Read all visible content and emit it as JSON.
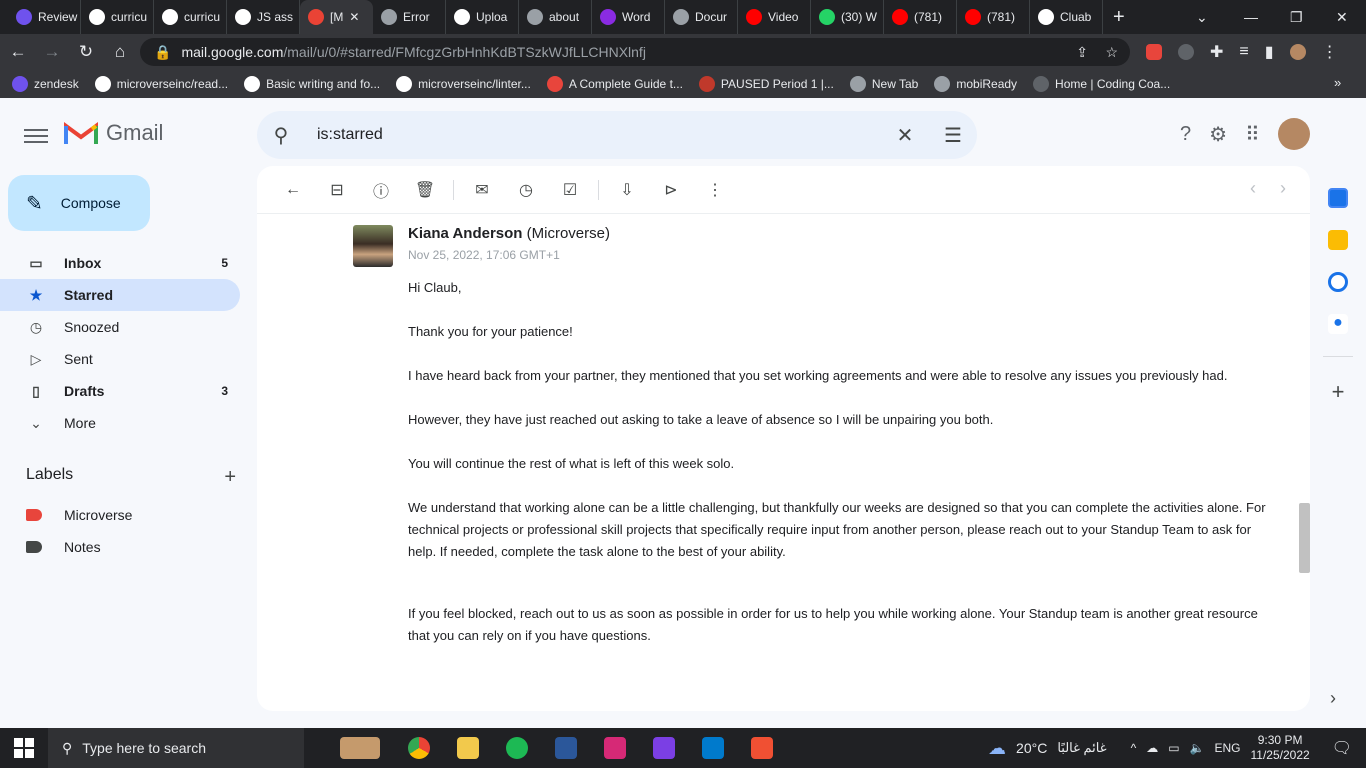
{
  "browser": {
    "tabs": [
      {
        "label": "Review",
        "favicon": "#6f52ed"
      },
      {
        "label": "curricu",
        "favicon": "#ffffff"
      },
      {
        "label": "curricu",
        "favicon": "#ffffff"
      },
      {
        "label": "JS ass",
        "favicon": "#ffffff"
      },
      {
        "label": "[M",
        "favicon": "#ea4335",
        "active": true
      },
      {
        "label": "Error",
        "favicon": "#9aa0a6"
      },
      {
        "label": "Uploa",
        "favicon": "#ffffff"
      },
      {
        "label": "about",
        "favicon": "#9aa0a6"
      },
      {
        "label": "Word",
        "favicon": "#8a2be2"
      },
      {
        "label": "Docur",
        "favicon": "#9aa0a6"
      },
      {
        "label": "Video",
        "favicon": "#ff0000"
      },
      {
        "label": "(30) W",
        "favicon": "#25d366"
      },
      {
        "label": "(781)",
        "favicon": "#ff0000"
      },
      {
        "label": "(781)",
        "favicon": "#ff0000"
      },
      {
        "label": "Cluab",
        "favicon": "#ffffff"
      }
    ],
    "url_host": "mail.google.com",
    "url_path": "/mail/u/0/#starred/FMfcgzGrbHnhKdBTSzkWJfLLCHNXlnfj",
    "bookmarks": [
      {
        "label": "zendesk"
      },
      {
        "label": "microverseinc/read..."
      },
      {
        "label": "Basic writing and fo..."
      },
      {
        "label": "microverseinc/linter..."
      },
      {
        "label": "A Complete Guide t..."
      },
      {
        "label": "PAUSED Period 1 |..."
      },
      {
        "label": "New Tab"
      },
      {
        "label": "mobiReady"
      },
      {
        "label": "Home | Coding Coa..."
      }
    ]
  },
  "gmail": {
    "logo_text": "Gmail",
    "search_value": "is:starred",
    "compose_label": "Compose",
    "nav": [
      {
        "label": "Inbox",
        "count": "5",
        "icon": "inbox-icon"
      },
      {
        "label": "Starred",
        "count": "",
        "icon": "star-icon"
      },
      {
        "label": "Snoozed",
        "count": "",
        "icon": "clock-icon"
      },
      {
        "label": "Sent",
        "count": "",
        "icon": "send-icon"
      },
      {
        "label": "Drafts",
        "count": "3",
        "icon": "draft-icon"
      },
      {
        "label": "More",
        "count": "",
        "icon": "chevron-down-icon"
      }
    ],
    "labels_title": "Labels",
    "labels": [
      {
        "label": "Microverse",
        "color": "#e8453c"
      },
      {
        "label": "Notes",
        "color": "#444746"
      }
    ],
    "message": {
      "sender_name": "Kiana Anderson",
      "sender_org": "(Microverse)",
      "date": "Nov 25, 2022, 17:06 GMT+1",
      "paragraphs": [
        "Hi Claub,",
        "Thank you for your patience!",
        "I have heard back from your partner, they mentioned that you set working agreements and were able to resolve any issues you previously had.",
        "However, they have just reached out asking to take a leave of absence so I will be unpairing you both.",
        "You will continue the rest of what is left of this week solo.",
        "We understand that working alone can be a little challenging, but thankfully our weeks are designed so that you can complete the activities alone. For technical projects or professional skill projects that specifically require input from another person, please reach out to your Standup Team to ask for help. If needed, complete the task alone to the best of your ability.",
        "If you feel blocked, reach out to us as soon as possible in order for us to help you while working alone. Your Standup team is another great resource that you can rely on if you have questions."
      ]
    }
  },
  "taskbar": {
    "search_placeholder": "Type here to search",
    "weather": "20°C",
    "weather_text": "غائم غالبًا",
    "language": "ENG",
    "time": "9:30 PM",
    "date": "11/25/2022"
  }
}
